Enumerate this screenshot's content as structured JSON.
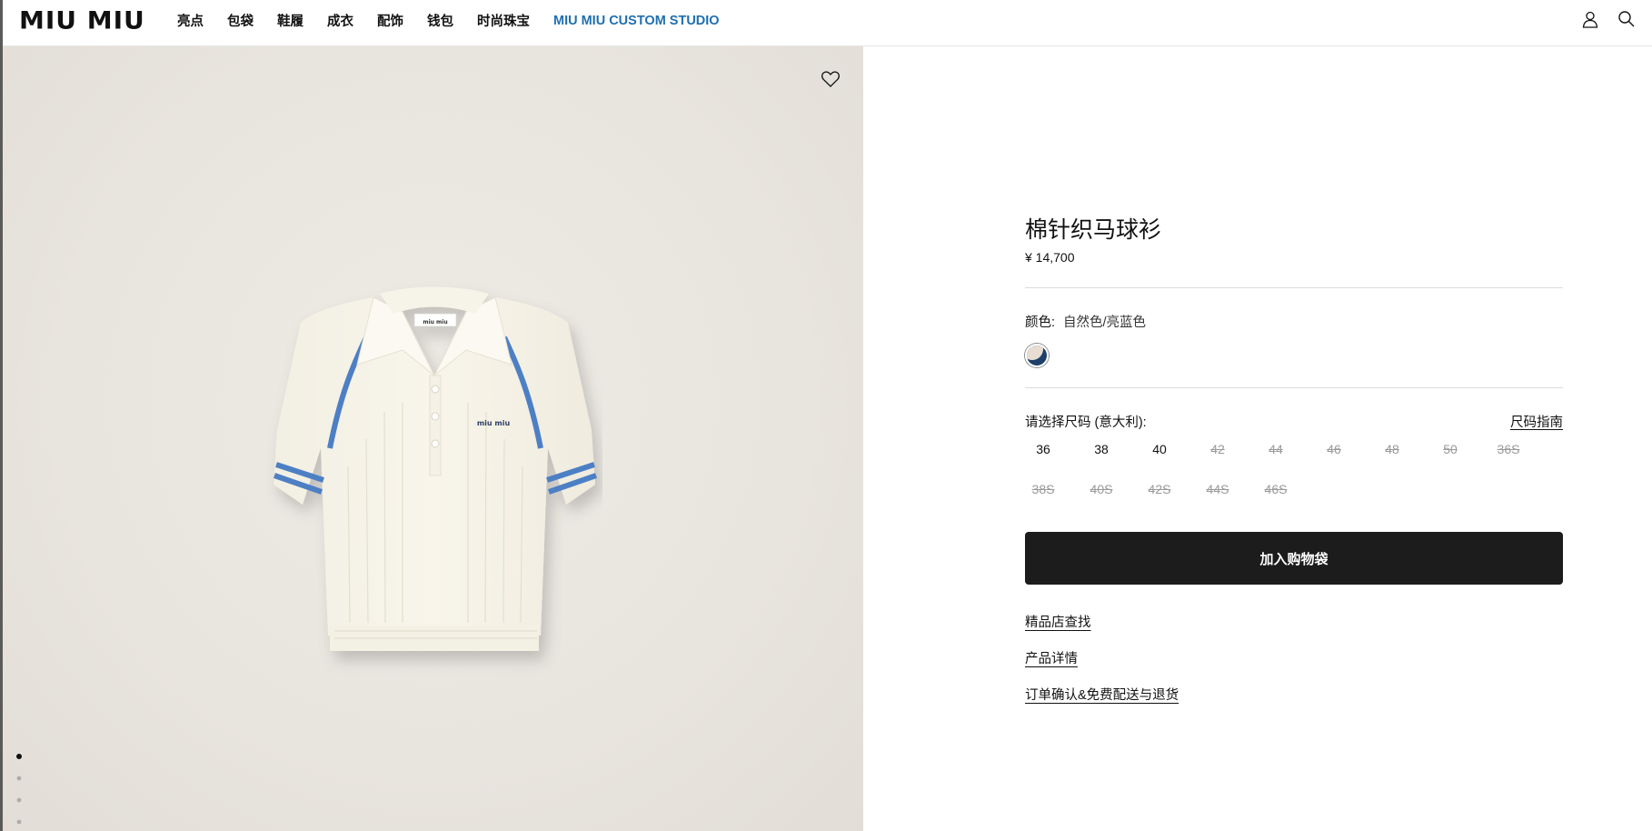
{
  "header": {
    "logo": "MIU MIU",
    "nav": [
      "亮点",
      "包袋",
      "鞋履",
      "成衣",
      "配饰",
      "钱包",
      "时尚珠宝",
      "MIU MIU CUSTOM STUDIO"
    ]
  },
  "product": {
    "title": "棉针织马球衫",
    "price": "¥ 14,700",
    "color_label": "颜色:",
    "color_value": "自然色/亮蓝色",
    "size_label": "请选择尺码 (意大利):",
    "size_guide": "尺码指南",
    "sizes": [
      {
        "label": "36",
        "available": true
      },
      {
        "label": "38",
        "available": true
      },
      {
        "label": "40",
        "available": true
      },
      {
        "label": "42",
        "available": false
      },
      {
        "label": "44",
        "available": false
      },
      {
        "label": "46",
        "available": false
      },
      {
        "label": "48",
        "available": false
      },
      {
        "label": "50",
        "available": false
      },
      {
        "label": "36S",
        "available": false
      },
      {
        "label": "38S",
        "available": false
      },
      {
        "label": "40S",
        "available": false
      },
      {
        "label": "42S",
        "available": false
      },
      {
        "label": "44S",
        "available": false
      },
      {
        "label": "46S",
        "available": false
      }
    ],
    "add_to_bag": "加入购物袋",
    "links": [
      "精品店查找",
      "产品详情",
      "订单确认&免费配送与退货"
    ]
  },
  "gallery": {
    "image_count": 4,
    "active_index": 0
  },
  "colors": {
    "accent": "#1f6fb0",
    "button_bg": "#1c1c1c",
    "swatch_primary": "#e7ddd2",
    "swatch_secondary": "#1d3f6a"
  }
}
